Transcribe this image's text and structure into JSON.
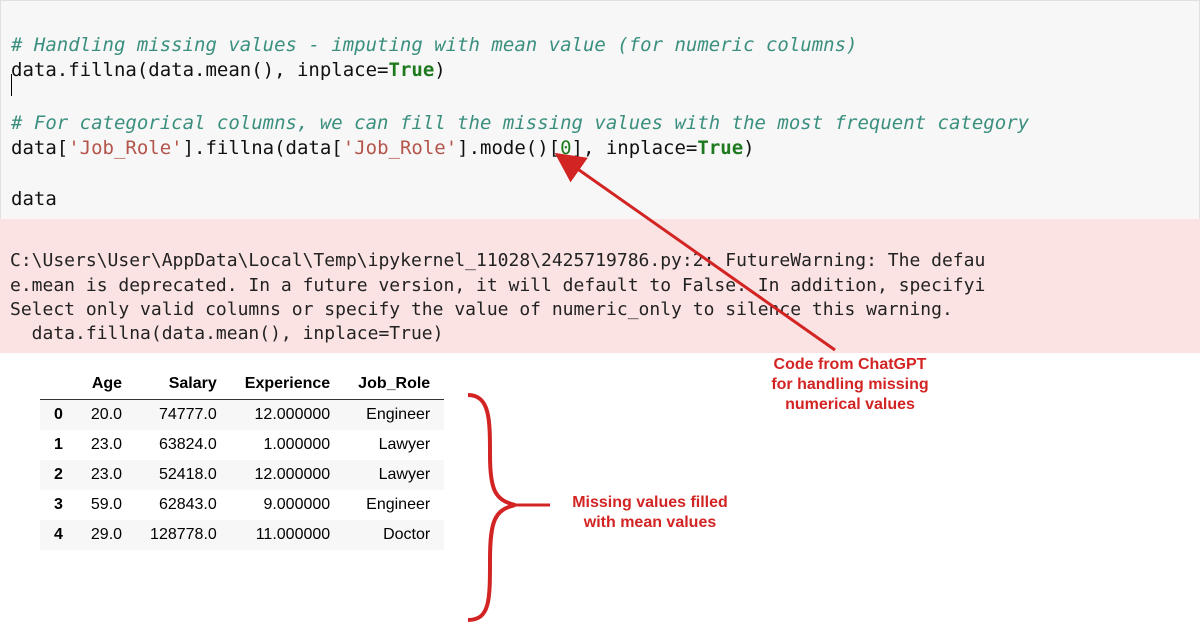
{
  "code": {
    "line1_comment": "# Handling missing values - imputing with mean value (for numeric columns)",
    "line2": "data.fillna(data.mean(), inplace=",
    "line2_true": "True",
    "line2_end": ")",
    "line4_comment": "# For categorical columns, we can fill the missing values with the most frequent category",
    "line5_a": "data[",
    "line5_s1": "'Job_Role'",
    "line5_b": "].fillna(data[",
    "line5_s2": "'Job_Role'",
    "line5_c": "].mode()[",
    "line5_num": "0",
    "line5_d": "], inplace=",
    "line5_true": "True",
    "line5_end": ")",
    "line7": "data"
  },
  "warning": {
    "l1": "C:\\Users\\User\\AppData\\Local\\Temp\\ipykernel_11028\\2425719786.py:2: FutureWarning: The defau",
    "l2": "e.mean is deprecated. In a future version, it will default to False. In addition, specifyi",
    "l3": "Select only valid columns or specify the value of numeric_only to silence this warning.",
    "l4": "  data.fillna(data.mean(), inplace=True)"
  },
  "table": {
    "cols": [
      "Age",
      "Salary",
      "Experience",
      "Job_Role"
    ],
    "rows": [
      {
        "idx": "0",
        "age": "20.0",
        "salary": "74777.0",
        "exp": "12.000000",
        "role": "Engineer"
      },
      {
        "idx": "1",
        "age": "23.0",
        "salary": "63824.0",
        "exp": "1.000000",
        "role": "Lawyer"
      },
      {
        "idx": "2",
        "age": "23.0",
        "salary": "52418.0",
        "exp": "12.000000",
        "role": "Lawyer"
      },
      {
        "idx": "3",
        "age": "59.0",
        "salary": "62843.0",
        "exp": "9.000000",
        "role": "Engineer"
      },
      {
        "idx": "4",
        "age": "29.0",
        "salary": "128778.0",
        "exp": "11.000000",
        "role": "Doctor"
      }
    ]
  },
  "annotations": {
    "top_l1": "Code from ChatGPT",
    "top_l2": "for handling missing",
    "top_l3": "numerical values",
    "mid_l1": "Missing values filled",
    "mid_l2": "with mean values"
  },
  "colors": {
    "annot_red": "#d32424"
  }
}
